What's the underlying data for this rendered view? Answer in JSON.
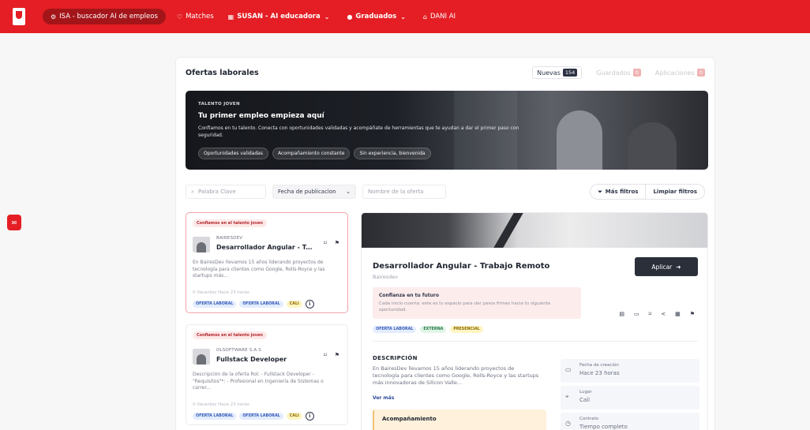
{
  "nav": {
    "items": [
      {
        "label": "ISA - buscador AI de empleos",
        "icon": "gear-icon"
      },
      {
        "label": "Matches",
        "icon": "heart-icon"
      },
      {
        "label": "SUSAN - AI educadora",
        "icon": "grid-icon"
      },
      {
        "label": "Graduados",
        "icon": "graduation-icon"
      },
      {
        "label": "DANI AI",
        "icon": "robot-icon"
      }
    ]
  },
  "offers": {
    "title": "Ofertas laborales",
    "tabs": [
      {
        "label": "Nuevas",
        "count": "154"
      },
      {
        "label": "Guardados",
        "count": "0"
      },
      {
        "label": "Aplicaciones",
        "count": "0"
      }
    ]
  },
  "hero": {
    "tag": "TALENTO JOVEN",
    "title": "Tu primer empleo empieza aquí",
    "description": "Confiamos en tu talento. Conecta con oportunidades validadas y acompáñate de herramientas que te ayudan a dar el primer paso con seguridad.",
    "chips": [
      "Oportunidades validadas",
      "Acompañamiento constante",
      "Sin experiencia, bienvenida"
    ]
  },
  "filters": {
    "keyword_placeholder": "Palabra Clave",
    "date_label": "Fecha de publicacion",
    "name_placeholder": "Nombre de la oferta",
    "more_label": "Más filtros",
    "clear_label": "Limpiar filtros"
  },
  "jobs": [
    {
      "badge": "Confiamos en el talento joven",
      "company": "BAIRESDEV",
      "title": "Desarrollador Angular - Trabajo Remoto",
      "description": "En BairesDev llevamos 15 años liderando proyectos de tecnología para clientes como Google, Rolls-Royce y las startups más...",
      "meta": "0 Vacantes  Hace 23 horas",
      "tags": [
        "OFERTA LABORAL",
        "OFERTA LABORAL",
        "CALI"
      ]
    },
    {
      "badge": "Confiamos en el talento joven",
      "company": "OLSOFTWARE S.A.S",
      "title": "Fullstack Developer",
      "description": "Descripción de la oferta Rol: - Fullstack Developer - \"Requisitos\"*: - Profesional en Ingeniería de Sistemas o carrer...",
      "meta": "0 Vacantes  Hace 23 horas",
      "tags": [
        "OFERTA LABORAL",
        "OFERTA LABORAL",
        "CALI"
      ]
    }
  ],
  "detail": {
    "title": "Desarrollador Angular - Trabajo Remoto",
    "company": "Bairesdev",
    "apply_label": "Aplicar",
    "trust_title": "Confianza en tu futuro",
    "trust_desc": "Cada inicio cuenta: este es tu espacio para dar pasos firmes hacia tu siguiente oportunidad.",
    "tags": [
      "OFERTA LABORAL",
      "EXTERNA",
      "PRESENCIAL"
    ],
    "desc_heading": "DESCRIPCIÓN",
    "desc_text": "En BairesDev llevamos 15 años liderando proyectos de tecnología para clientes como Google, Rolls-Royce y las startups más innovadoras de Silicon Valle...",
    "more_label": "Ver más",
    "acomp_title": "Acompañamiento",
    "info": [
      {
        "label": "Fecha de creación",
        "value": "Hace 23 horas",
        "icon": "calendar-icon"
      },
      {
        "label": "Lugar",
        "value": "Cali",
        "icon": "location-icon"
      },
      {
        "label": "Contrato",
        "value": "Tiempo completo",
        "icon": "clock-icon"
      }
    ]
  },
  "colors": {
    "brand": "#e41e24",
    "dark": "#2b2f3a"
  }
}
